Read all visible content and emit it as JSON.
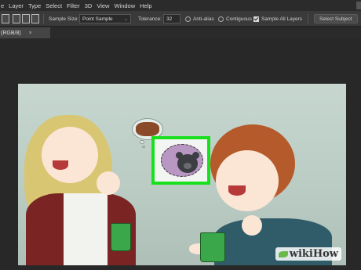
{
  "menu": {
    "items": [
      "e",
      "Layer",
      "Type",
      "Select",
      "Filter",
      "3D",
      "View",
      "Window",
      "Help"
    ]
  },
  "options": {
    "sample_size_label": "Sample Size:",
    "sample_size_value": "Point Sample",
    "tolerance_label": "Tolerance:",
    "tolerance_value": "32",
    "anti_alias_label": "Anti-alias",
    "contiguous_label": "Contiguous",
    "sample_all_layers_label": "Sample All Layers",
    "select_subject_label": "Select Subject"
  },
  "document": {
    "tab_label": "(RGB/8)",
    "close_glyph": "×"
  },
  "watermark": {
    "brand_prefix": "wiki",
    "brand_suffix": "How"
  },
  "colors": {
    "selection": "#19e01f",
    "selected_bubble": "#b897c2"
  }
}
